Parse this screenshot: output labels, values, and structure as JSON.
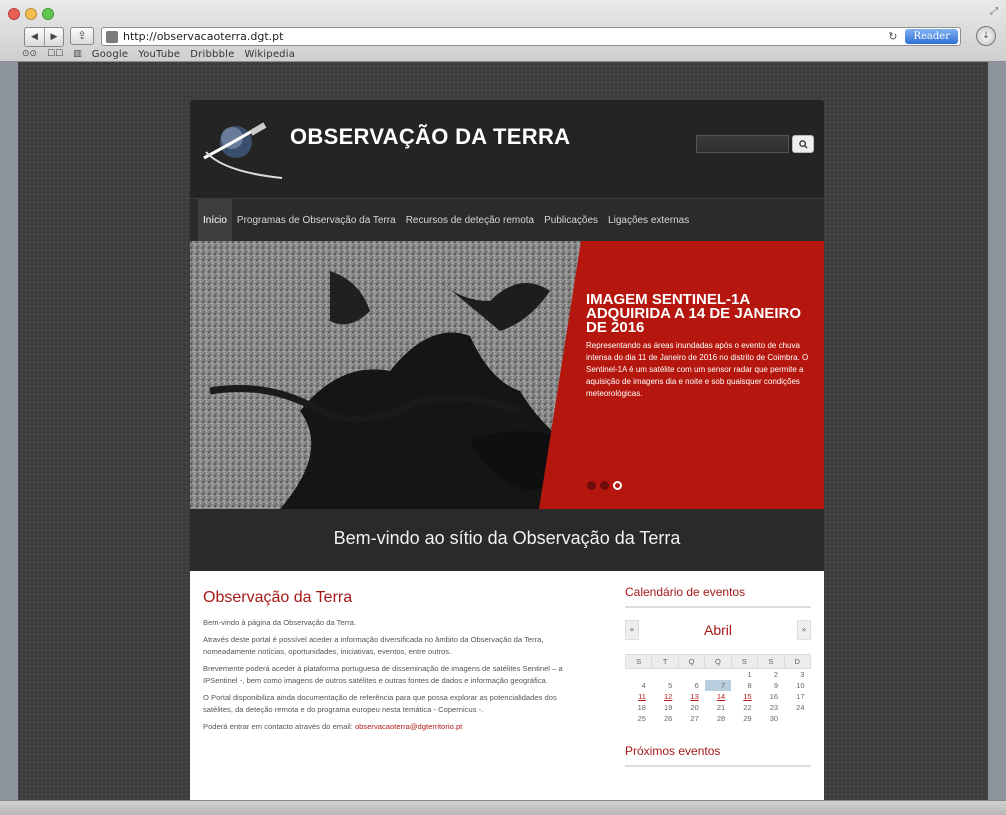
{
  "browser": {
    "url": "http://observacaoterra.dgt.pt",
    "reader_label": "Reader",
    "bookmarks": [
      "Google",
      "YouTube",
      "Dribbble",
      "Wikipedia"
    ]
  },
  "site": {
    "title": "OBSERVAÇÃO DA TERRA",
    "search_placeholder": "",
    "nav": [
      "Início",
      "Programas de Observação da Terra",
      "Recursos de deteção remota",
      "Publicações",
      "Ligações externas"
    ],
    "slide": {
      "title": "Imagem Sentinel-1A adquirida a 14 de Janeiro de 2016",
      "body": "Representando as áreas inundadas após o evento de chuva intensa do dia 11 de Janeiro de 2016 no distrito de Coimbra. O Sentinel-1A é um satélite com um sensor radar que permite a aquisição de imagens dia e noite e sob quaisquer condições meteorológicas.",
      "dot_count": 3,
      "active_dot": 3
    },
    "welcome": "Bem-vindo ao sítio da Observação da Terra",
    "main": {
      "title": "Observação da Terra",
      "p1": "Bem-vindo à página da Observação da Terra.",
      "p2": "Através deste portal é possível aceder a informação diversificada no âmbito da Observação da Terra, nomeadamente notícias, oportunidades, iniciativas, eventos, entre outros.",
      "p3": "Brevemente poderá aceder à plataforma portuguesa de disseminação de imagens de satélites Sentinel – a IPSentinel -, bem como imagens de outros satélites e outras fontes de dados e informação geográfica.",
      "p4": "O Portal disponibiliza ainda documentação de referência para que possa explorar as potencialidades dos satélites, da deteção remota e do programa europeu nesta temática - Copernicus -.",
      "p5_prefix": "Poderá entrar em contacto através do email: ",
      "email": "observacaoterra@dgterritorio.pt"
    },
    "calendar": {
      "title": "Calendário de eventos",
      "prev": "«",
      "next": "»",
      "month": "Abril",
      "weekdays": [
        "S",
        "T",
        "Q",
        "Q",
        "S",
        "S",
        "D"
      ],
      "weeks": [
        [
          "",
          "",
          "",
          "",
          "1",
          "2",
          "3"
        ],
        [
          "4",
          "5",
          "6",
          "7",
          "8",
          "9",
          "10"
        ],
        [
          "11",
          "12",
          "13",
          "14",
          "15",
          "16",
          "17"
        ],
        [
          "18",
          "19",
          "20",
          "21",
          "22",
          "23",
          "24"
        ],
        [
          "25",
          "26",
          "27",
          "28",
          "29",
          "30",
          ""
        ]
      ],
      "event_days": [
        "11",
        "12",
        "13",
        "14",
        "15"
      ],
      "today": "7"
    },
    "next_events_title": "Próximos eventos"
  }
}
